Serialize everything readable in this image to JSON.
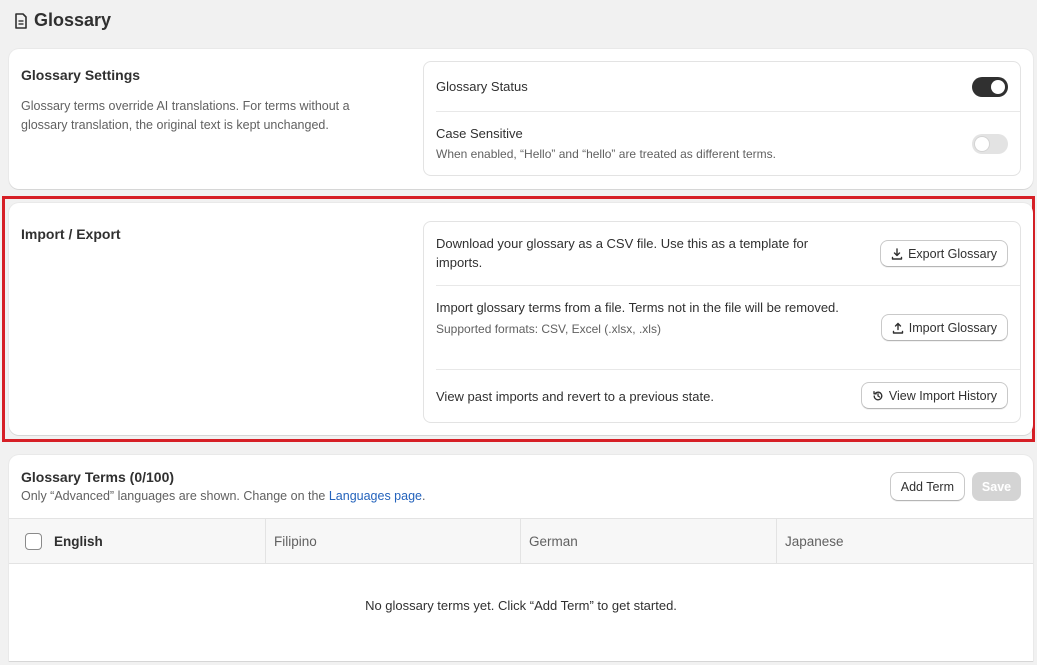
{
  "page": {
    "title": "Glossary",
    "icon": "document-icon"
  },
  "settings": {
    "title": "Glossary Settings",
    "description": "Glossary terms override AI translations. For terms without a glossary translation, the original text is kept unchanged.",
    "status_label": "Glossary Status",
    "status_on": true,
    "case_label": "Case Sensitive",
    "case_sub": "When enabled, “Hello” and “hello” are treated as different terms.",
    "case_on": false
  },
  "import_export": {
    "title": "Import / Export",
    "export_text": "Download your glossary as a CSV file. Use this as a template for imports.",
    "export_button": "Export Glossary",
    "import_text": "Import glossary terms from a file. Terms not in the file will be removed.",
    "import_sub": "Supported formats: CSV, Excel (.xlsx, .xls)",
    "import_button": "Import Glossary",
    "history_text": "View past imports and revert to a previous state.",
    "history_button": "View Import History"
  },
  "terms": {
    "title": "Glossary Terms (0/100)",
    "subtitle_prefix": "Only “Advanced” languages are shown. Change on the ",
    "subtitle_link": "Languages page",
    "subtitle_suffix": ".",
    "add_button": "Add Term",
    "save_button": "Save",
    "columns": [
      "English",
      "Filipino",
      "German",
      "Japanese"
    ],
    "empty_message": "No glossary terms yet. Click “Add Term” to get started."
  },
  "colors": {
    "highlight": "#d61f26",
    "link": "#2463bc",
    "toggle_on": "#303030"
  }
}
